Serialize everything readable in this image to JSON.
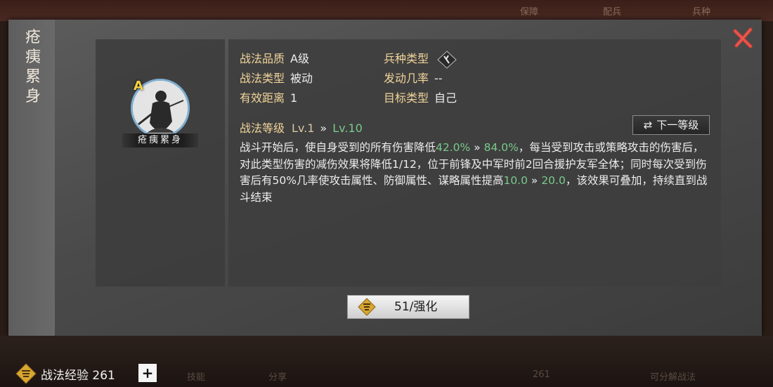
{
  "background": {
    "top_tabs": [
      "保障",
      "配兵",
      "兵种"
    ],
    "bottom_ghost": [
      "技能",
      "分享",
      "261",
      "可分解战法"
    ]
  },
  "dialog": {
    "side_title": "疮痍累身",
    "skill": {
      "grade": "A",
      "name_label": "疮痍累身"
    },
    "info": {
      "quality_label": "战法品质",
      "quality_value": "A级",
      "type_label": "战法类型",
      "type_value": "被动",
      "range_label": "有效距离",
      "range_value": "1",
      "troop_label": "兵种类型",
      "rate_label": "发动几率",
      "rate_value": "--",
      "target_label": "目标类型",
      "target_value": "自己"
    },
    "level": {
      "label": "战法等级",
      "current": "Lv.1",
      "arrow": "»",
      "max": "Lv.10",
      "next_button": "下一等级"
    },
    "description": {
      "t1": "战斗开始后，使自身受到的所有伤害降低",
      "v1": "42.0%",
      "a1": " » ",
      "v2": "84.0%",
      "t2": "，每当受到攻击或策略攻击的伤害后，对此类型伤害的减伤效果将降低1/12，位于前锋及中军时前2回合援护友军全体；同时每次受到伤害后有50%几率使攻击属性、防御属性、谋略属性提高",
      "v3": "10.0",
      "a2": " » ",
      "v4": "20.0",
      "t3": "，该效果可叠加，持续直到战斗结束"
    },
    "enhance_button": "51/强化"
  },
  "bottom": {
    "exp_label": "战法经验 261",
    "plus": "+"
  },
  "colors": {
    "green_value": "#79c98c",
    "gold_label": "#f1d49a",
    "close_red": "#d9433b"
  }
}
